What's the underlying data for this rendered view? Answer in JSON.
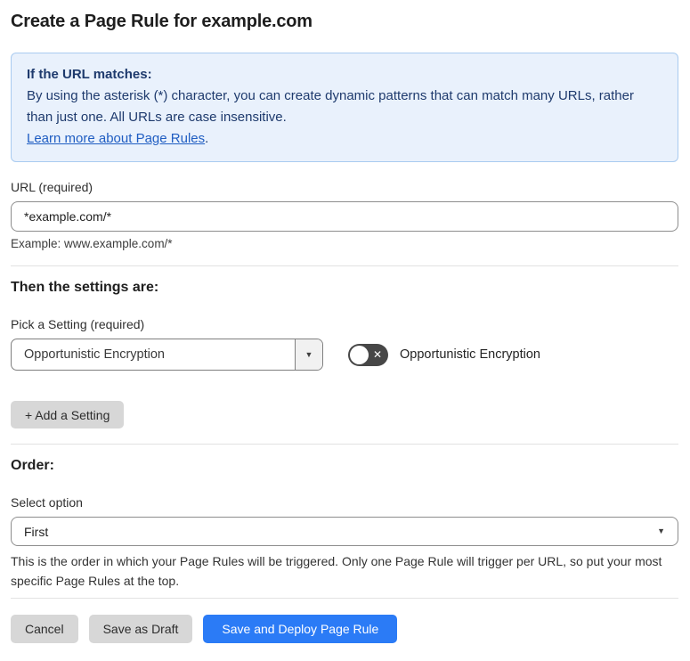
{
  "page": {
    "title": "Create a Page Rule for example.com"
  },
  "info_box": {
    "heading": "If the URL matches:",
    "body": "By using the asterisk (*) character, you can create dynamic patterns that can match many URLs, rather than just one. All URLs are case insensitive.",
    "link_label": "Learn more about Page Rules",
    "link_suffix": "."
  },
  "url_field": {
    "label": "URL (required)",
    "value": "*example.com/*",
    "example": "Example: www.example.com/*"
  },
  "settings_section": {
    "heading": "Then the settings are:",
    "picker_label": "Pick a Setting (required)",
    "selected_setting": "Opportunistic Encryption",
    "toggle_state": "off",
    "toggle_off_icon": "✕",
    "toggle_label": "Opportunistic Encryption",
    "add_setting_button": "+ Add a Setting",
    "dropdown_caret": "▼"
  },
  "order_section": {
    "heading": "Order:",
    "select_label": "Select option",
    "selected_option": "First",
    "select_caret": "▼",
    "help_text": "This is the order in which your Page Rules will be triggered. Only one Page Rule will trigger per URL, so put your most specific Page Rules at the top."
  },
  "footer": {
    "cancel_label": "Cancel",
    "save_draft_label": "Save as Draft",
    "save_deploy_label": "Save and Deploy Page Rule"
  },
  "colors": {
    "info_bg": "#e9f1fc",
    "info_border": "#a9cbf0",
    "info_text": "#1e3a6d",
    "link_blue": "#1f5dc2",
    "primary_blue": "#2b7bf6",
    "toggle_off_bg": "#474747",
    "gray_button_bg": "#d7d7d7"
  }
}
